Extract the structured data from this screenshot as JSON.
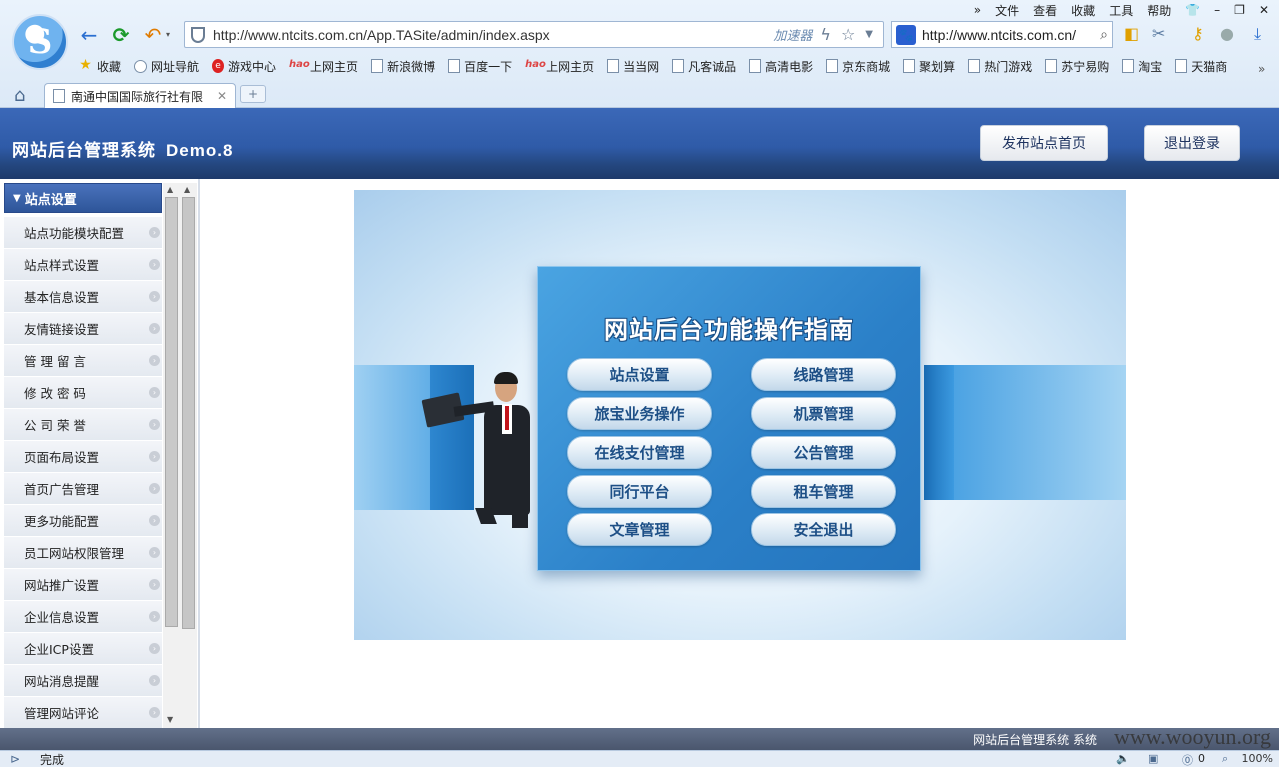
{
  "browser": {
    "menu": [
      "文件",
      "查看",
      "收藏",
      "工具",
      "帮助"
    ],
    "address": "http://www.ntcits.com.cn/App.TASite/admin/index.aspx",
    "accelerator": "加速器",
    "search_text": "http://www.ntcits.com.cn/",
    "favorites": [
      {
        "label": "收藏",
        "icon": "star-icon"
      },
      {
        "label": "网址导航",
        "icon": "globe-icon"
      },
      {
        "label": "游戏中心",
        "icon": "game-icon"
      },
      {
        "label": "上网主页",
        "icon": "hao-icon"
      },
      {
        "label": "新浪微博",
        "icon": "page-icon"
      },
      {
        "label": "百度一下",
        "icon": "page-icon"
      },
      {
        "label": "上网主页",
        "icon": "hao-icon"
      },
      {
        "label": "当当网",
        "icon": "page-icon"
      },
      {
        "label": "凡客诚品",
        "icon": "page-icon"
      },
      {
        "label": "高清电影",
        "icon": "page-icon"
      },
      {
        "label": "京东商城",
        "icon": "page-icon"
      },
      {
        "label": "聚划算",
        "icon": "page-icon"
      },
      {
        "label": "热门游戏",
        "icon": "page-icon"
      },
      {
        "label": "苏宁易购",
        "icon": "page-icon"
      },
      {
        "label": "淘宝",
        "icon": "page-icon"
      },
      {
        "label": "天猫商",
        "icon": "page-icon"
      }
    ],
    "tab_title": "南通中国国际旅行社有限",
    "status_text": "完成",
    "zoom": "100%",
    "download_count": "0"
  },
  "app": {
    "title": "网站后台管理系统",
    "version": "Demo.8",
    "publish_button": "发布站点首页",
    "logout_button": "退出登录"
  },
  "sidebar": {
    "header": "站点设置",
    "items": [
      "站点功能模块配置",
      "站点样式设置",
      "基本信息设置",
      "友情链接设置",
      "管 理 留 言",
      "修 改 密 码",
      "公 司 荣 誉",
      "页面布局设置",
      "首页广告管理",
      "更多功能配置",
      "员工网站权限管理",
      "网站推广设置",
      "企业信息设置",
      "企业ICP设置",
      "网站消息提醒",
      "管理网站评论"
    ]
  },
  "guide": {
    "title": "网站后台功能操作指南",
    "buttons": [
      "站点设置",
      "线路管理",
      "旅宝业务操作",
      "机票管理",
      "在线支付管理",
      "公告管理",
      "同行平台",
      "租车管理",
      "文章管理",
      "安全退出"
    ]
  },
  "footer": {
    "text": "网站后台管理系统  系统",
    "watermark": "www.wooyun.org"
  },
  "colors": {
    "header_blue": "#2f5ba8",
    "panel_blue": "#2b80c8",
    "guide_button_text": "#1d4f86"
  }
}
